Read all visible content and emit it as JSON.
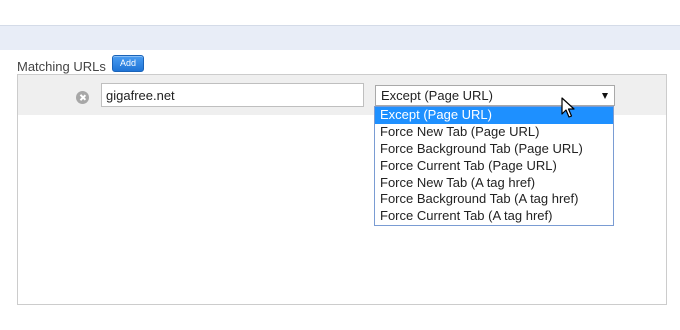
{
  "section": {
    "label": "Matching URLs",
    "add_label": "Add"
  },
  "url_row": {
    "value": "gigafree.net",
    "remove_icon": "close-circle-icon",
    "mode_selected": "Except (Page URL)",
    "caret_icon": "caret-down-icon"
  },
  "dropdown": {
    "options": [
      "Except (Page URL)",
      "Force New Tab (Page URL)",
      "Force Background Tab (Page URL)",
      "Force Current Tab (Page URL)",
      "Force New Tab (A tag href)",
      "Force Background Tab (A tag href)",
      "Force Current Tab (A tag href)"
    ],
    "highlighted": "Except (Page URL)"
  },
  "colors": {
    "accent": "#1e90ff",
    "add_button": "#2a80e0",
    "band": "#e8edf7"
  },
  "cursor": "arrow-pointer-icon"
}
